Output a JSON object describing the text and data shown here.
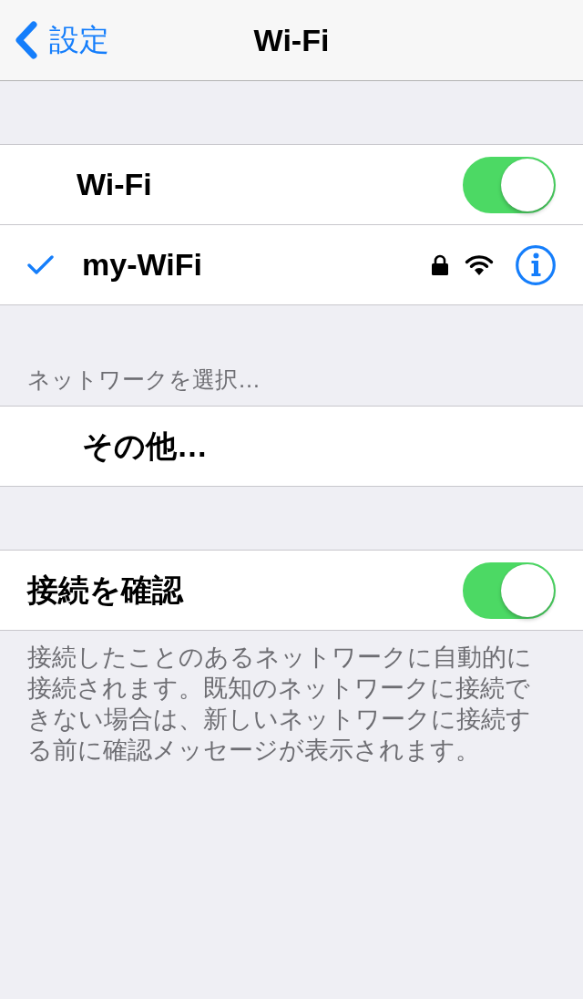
{
  "nav_bar": {
    "back_label": "設定",
    "title": "Wi-Fi"
  },
  "wifi_group": {
    "rows": [
      {
        "kind": "toggle",
        "label": "Wi-Fi",
        "on": true
      },
      {
        "kind": "network",
        "label": "my-WiFi",
        "selected": true,
        "locked": true
      }
    ]
  },
  "choose_network": {
    "header": "ネットワークを選択…",
    "rows": [
      {
        "kind": "other",
        "label": "その他…"
      }
    ]
  },
  "ask_to_join": {
    "rows": [
      {
        "kind": "toggle",
        "label": "接続を確認",
        "on": true
      }
    ],
    "footnote": "接続したことのあるネットワークに自動的に接続されます。既知のネットワークに接続できない場合は、新しいネットワークに接続する前に確認メッセージが表示されます。"
  }
}
